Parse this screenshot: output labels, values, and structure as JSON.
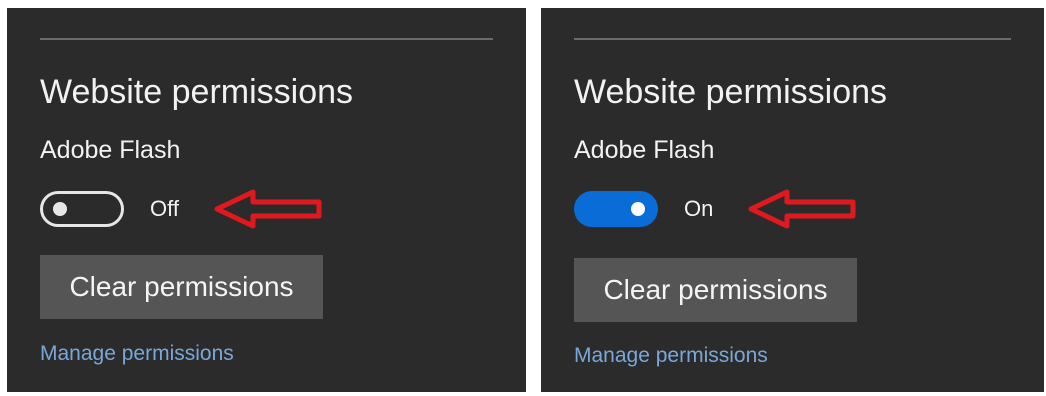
{
  "left_panel": {
    "heading": "Website permissions",
    "permission_label": "Adobe Flash",
    "toggle": {
      "state": "off",
      "state_label": "Off"
    },
    "clear_button_label": "Clear permissions",
    "manage_link_label": "Manage permissions"
  },
  "right_panel": {
    "heading": "Website permissions",
    "permission_label": "Adobe Flash",
    "toggle": {
      "state": "on",
      "state_label": "On"
    },
    "clear_button_label": "Clear permissions",
    "manage_link_label": "Manage permissions"
  },
  "annotation": {
    "icon": "red-left-arrow-icon",
    "color": "#e0191f"
  },
  "colors": {
    "panel_background": "#2b2b2b",
    "toggle_on": "#0a6cd6",
    "button_background": "#555555",
    "link": "#7aa7d9"
  }
}
